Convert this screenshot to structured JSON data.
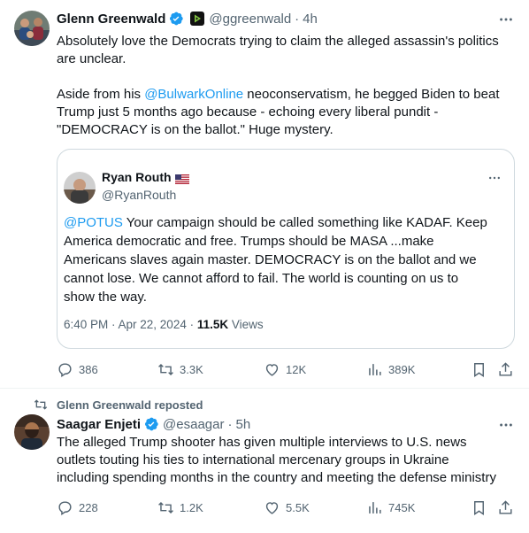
{
  "tweet1": {
    "name": "Glenn Greenwald",
    "handle": "@ggreenwald",
    "dot": "·",
    "time": "4h",
    "text_line1": "Absolutely love the Democrats trying to claim the alleged assassin's politics",
    "text_line2": "are unclear.",
    "text_p2_pre": "Aside from his ",
    "text_p2_mention": "@BulwarkOnline",
    "text_p2_post": " neoconservatism, he begged Biden to beat",
    "text_line4": "Trump just 5 months ago because - echoing every liberal pundit -",
    "text_line5": "\"DEMOCRACY is on the ballot.\" Huge mystery.",
    "quote": {
      "name": "Ryan Routh",
      "handle": "@RyanRouth",
      "mention": "@POTUS",
      "text_line1_rest": " Your campaign should be called something like KADAF. Keep",
      "text_line2": "America democratic and free. Trumps should be MASA ...make",
      "text_line3": "Americans slaves again master. DEMOCRACY is on the ballot and we",
      "text_line4": "cannot lose. We cannot afford to fail. The world is counting on us to",
      "text_line5": "show the way.",
      "timestamp": "6:40 PM · Apr 22, 2024 · ",
      "views_count": "11.5K",
      "views_label": " Views"
    },
    "stats": {
      "replies": "386",
      "reposts": "3.3K",
      "likes": "12K",
      "views": "389K"
    }
  },
  "repost_label": "Glenn Greenwald reposted",
  "tweet2": {
    "name": "Saagar Enjeti",
    "handle": "@esaagar",
    "dot": "·",
    "time": "5h",
    "text_line1": "The alleged Trump shooter has given multiple interviews to U.S. news",
    "text_line2": "outlets touting his ties to international mercenary groups in Ukraine",
    "text_line3": "including spending months in the country and meeting the defense ministry",
    "stats": {
      "replies": "228",
      "reposts": "1.2K",
      "likes": "5.5K",
      "views": "745K"
    }
  },
  "colors": {
    "accent": "#1d9bf0",
    "muted": "#536471",
    "text": "#0f1419",
    "border": "#cfd9de"
  },
  "icons": [
    "verified-badge-icon",
    "rumble-icon",
    "more-icon",
    "reply-icon",
    "repost-icon",
    "like-icon",
    "views-icon",
    "bookmark-icon",
    "share-icon",
    "us-flag-icon"
  ]
}
